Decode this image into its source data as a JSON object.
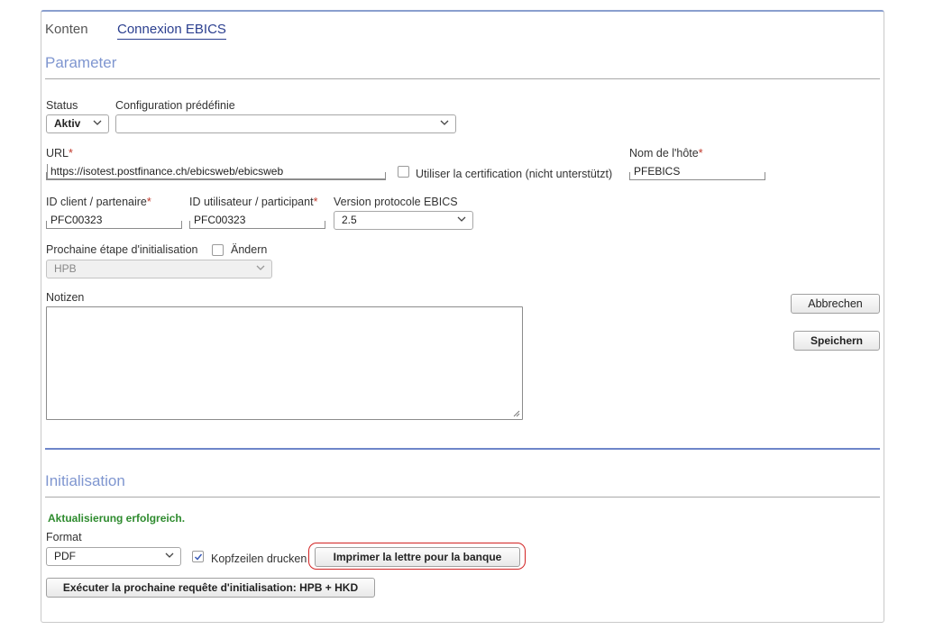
{
  "tabs": [
    {
      "label": "Konten",
      "active": false
    },
    {
      "label": "Connexion EBICS",
      "active": true
    }
  ],
  "parameter": {
    "title": "Parameter",
    "status": {
      "label": "Status",
      "value": "Aktiv"
    },
    "config": {
      "label": "Configuration prédéfinie",
      "value": ""
    },
    "url": {
      "label": "URL",
      "required": "*",
      "value": "https://isotest.postfinance.ch/ebicsweb/ebicsweb"
    },
    "certification": {
      "label": "Utiliser la certification (nicht unterstützt)",
      "checked": false
    },
    "host": {
      "label": "Nom de l'hôte",
      "required": "*",
      "value": "PFEBICS"
    },
    "client_id": {
      "label": "ID client / partenaire",
      "required": "*",
      "value": "PFC00323"
    },
    "user_id": {
      "label": "ID utilisateur / participant",
      "required": "*",
      "value": "PFC00323"
    },
    "protocol": {
      "label": "Version protocole EBICS",
      "value": "2.5"
    },
    "next_step": {
      "label": "Prochaine étape d'initialisation",
      "change_label": "Ändern",
      "change_checked": false,
      "value": "HPB"
    },
    "notes": {
      "label": "Notizen",
      "value": ""
    },
    "cancel_label": "Abbrechen",
    "save_label": "Speichern"
  },
  "initialisation": {
    "title": "Initialisation",
    "success_message": "Aktualisierung erfolgreich.",
    "format": {
      "label": "Format",
      "value": "PDF"
    },
    "headers": {
      "label": "Kopfzeilen drucken",
      "checked": true
    },
    "print_label": "Imprimer la lettre pour la banque",
    "execute_label": "Exécuter la prochaine requête d'initialisation: HPB + HKD"
  },
  "colors": {
    "accent": "#2b3f8f",
    "section_title": "#7f96d0",
    "success": "#2e8b2e",
    "required": "#c0392b",
    "highlight": "#d22424"
  }
}
